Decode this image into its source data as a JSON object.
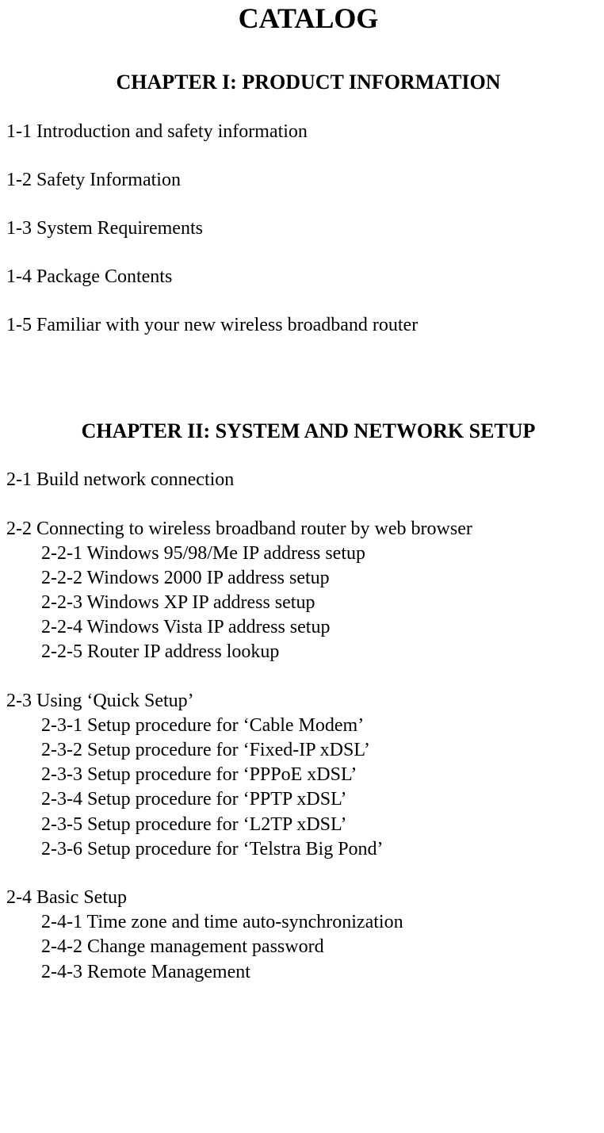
{
  "title": "CATALOG",
  "chapter1": {
    "heading": "CHAPTER I:    PRODUCT INFORMATION",
    "items": [
      "1-1 Introduction and safety information",
      "1-2 Safety Information",
      "1-3 System Requirements",
      "1-4 Package Contents",
      "1-5 Familiar with your new wireless broadband router"
    ]
  },
  "chapter2": {
    "heading": "CHAPTER II:    SYSTEM AND NETWORK SETUP",
    "s1": "2-1 Build network connection",
    "s2": {
      "head": "2-2 Connecting to wireless broadband router by web browser",
      "sub": [
        "2-2-1 Windows 95/98/Me IP address setup",
        "2-2-2 Windows 2000 IP address setup",
        "2-2-3 Windows XP IP address setup",
        "2-2-4 Windows Vista IP address setup",
        "2-2-5 Router IP address lookup"
      ]
    },
    "s3": {
      "head": "2-3 Using ‘Quick Setup’",
      "sub": [
        "2-3-1 Setup procedure for ‘Cable Modem’",
        "2-3-2 Setup procedure for ‘Fixed-IP xDSL’",
        "2-3-3 Setup procedure for ‘PPPoE xDSL’",
        "2-3-4 Setup procedure for ‘PPTP xDSL’",
        "2-3-5 Setup procedure for ‘L2TP xDSL’",
        "2-3-6 Setup procedure for ‘Telstra Big Pond’"
      ]
    },
    "s4": {
      "head": "2-4 Basic Setup",
      "sub": [
        "2-4-1 Time zone and time auto-synchronization",
        "2-4-2 Change management password",
        "2-4-3 Remote Management"
      ]
    }
  }
}
